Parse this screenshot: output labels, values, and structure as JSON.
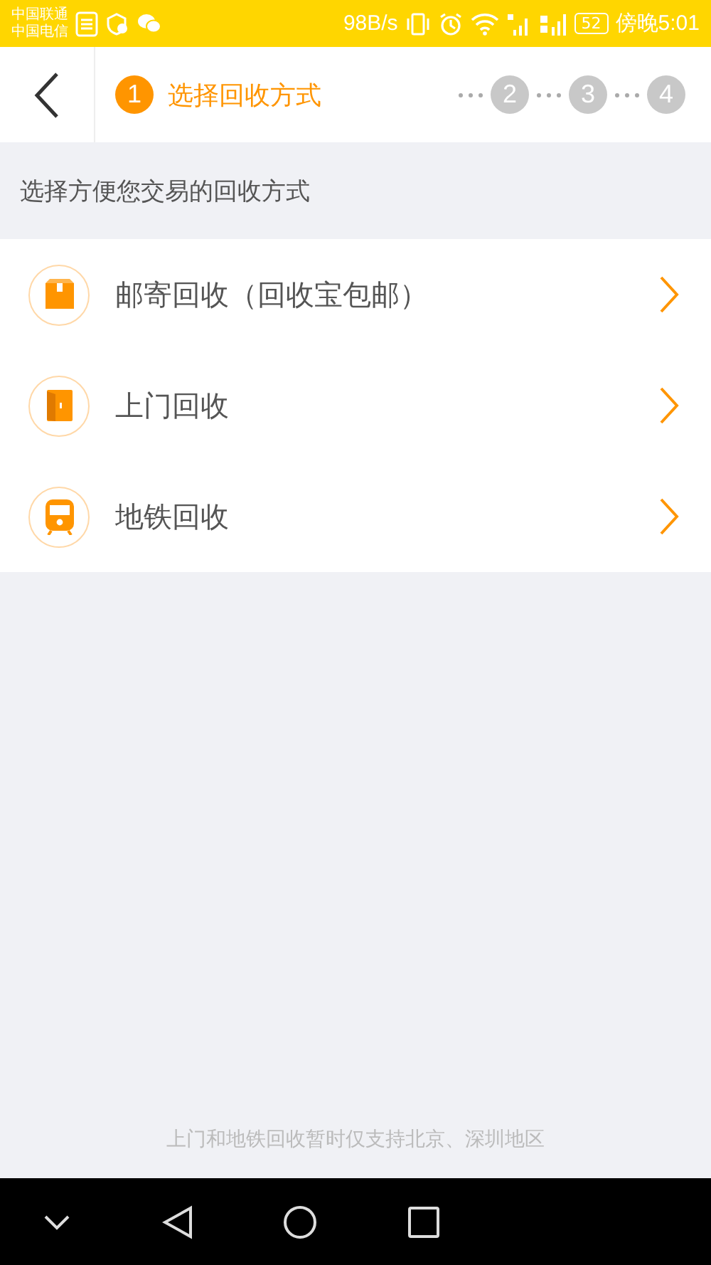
{
  "status_bar": {
    "carriers": [
      "中国联通",
      "中国电信"
    ],
    "speed": "98B/s",
    "battery": "52",
    "time": "傍晚5:01"
  },
  "header": {
    "steps": [
      {
        "number": "1",
        "label": "选择回收方式",
        "selected": true
      },
      {
        "number": "2",
        "selected": false
      },
      {
        "number": "3",
        "selected": false
      },
      {
        "number": "4",
        "selected": false
      }
    ]
  },
  "subtitle": "选择方便您交易的回收方式",
  "methods": [
    {
      "kind": "mail",
      "label": "邮寄回收（回收宝包邮）"
    },
    {
      "kind": "door",
      "label": "上门回收"
    },
    {
      "kind": "subway",
      "label": "地铁回收"
    }
  ],
  "footer_note": "上门和地铁回收暂时仅支持北京、深圳地区"
}
